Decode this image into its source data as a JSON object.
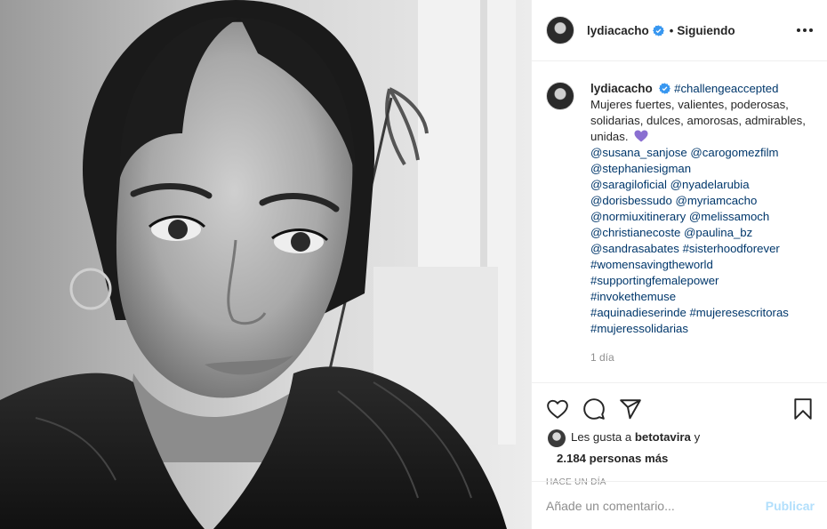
{
  "post": {
    "username": "lydiacacho",
    "dot": "•",
    "following_label": "Siguiendo",
    "caption_hashtag": "#challengeaccepted",
    "caption_text": "Mujeres fuertes, valientes, poderosas, solidarias, dulces, amorosas, admirables, unidas.",
    "mentions": [
      "@susana_sanjose",
      "@carogomezfilm",
      "@stephaniesigman",
      "@saragiloficial",
      "@nyadelarubia",
      "@dorisbessudo",
      "@myriamcacho",
      "@normiuxitinerary",
      "@melissamoch",
      "@christianecoste",
      "@paulina_bz",
      "@sandrasabates"
    ],
    "hashtags": [
      "#sisterhoodforever",
      "#womensavingtheworld",
      "#supportingfemalepower",
      "#invokethemuse",
      "#aquinadieserinde",
      "#mujeresescritoras",
      "#mujeressolidarias"
    ],
    "caption_time": "1 día",
    "likes_prefix": "Les gusta a",
    "likes_user": "betotavira",
    "likes_and": "y",
    "likes_count": "2.184 personas más",
    "post_date": "HACE UN DÍA",
    "comment_placeholder": "Añade un comentario...",
    "publish_label": "Publicar"
  },
  "icons": {
    "verified": "verified-badge-icon",
    "heart_emoji": "purple-heart-emoji",
    "like": "heart-icon",
    "comment": "comment-icon",
    "share": "paper-plane-icon",
    "save": "bookmark-icon",
    "more": "ellipsis-icon"
  },
  "colors": {
    "link": "#00376b",
    "verified": "#3897f0",
    "publish_disabled": "#b2dffc",
    "heart_emoji": "#8a6fd1"
  }
}
